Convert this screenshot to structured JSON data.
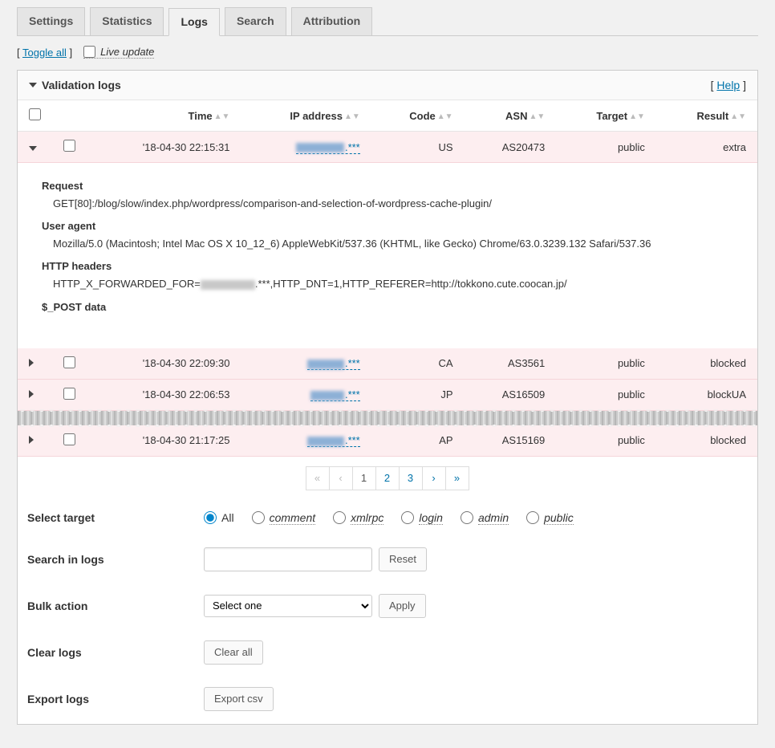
{
  "tabs": [
    {
      "label": "Settings"
    },
    {
      "label": "Statistics"
    },
    {
      "label": "Logs",
      "active": true
    },
    {
      "label": "Search"
    },
    {
      "label": "Attribution"
    }
  ],
  "toggle_all": "Toggle all",
  "live_update": "Live update",
  "panel_title": "Validation logs",
  "help": "Help",
  "columns": {
    "time": "Time",
    "ip": "IP address",
    "code": "Code",
    "asn": "ASN",
    "target": "Target",
    "result": "Result"
  },
  "rows": [
    {
      "time": "'18-04-30 22:15:31",
      "ip": ".***",
      "code": "US",
      "asn": "AS20473",
      "target": "public",
      "result": "extra",
      "expanded": true
    },
    {
      "time": "'18-04-30 22:09:30",
      "ip": ".***",
      "code": "CA",
      "asn": "AS3561",
      "target": "public",
      "result": "blocked",
      "expanded": false
    },
    {
      "time": "'18-04-30 22:06:53",
      "ip": ".***",
      "code": "JP",
      "asn": "AS16509",
      "target": "public",
      "result": "blockUA",
      "expanded": false
    },
    {
      "time": "'18-04-30 21:17:25",
      "ip": ".***",
      "code": "AP",
      "asn": "AS15169",
      "target": "public",
      "result": "blocked",
      "expanded": false
    }
  ],
  "detail": {
    "request_label": "Request",
    "request": "GET[80]:/blog/slow/index.php/wordpress/comparison-and-selection-of-wordpress-cache-plugin/",
    "ua_label": "User agent",
    "ua": "Mozilla/5.0 (Macintosh; Intel Mac OS X 10_12_6) AppleWebKit/537.36 (KHTML, like Gecko) Chrome/63.0.3239.132 Safari/537.36",
    "headers_label": "HTTP headers",
    "headers_pre": "HTTP_X_FORWARDED_FOR=",
    "headers_post": ".***,HTTP_DNT=1,HTTP_REFERER=http://tokkono.cute.coocan.jp/",
    "post_label": "$_POST data"
  },
  "pager": {
    "pages": [
      "1",
      "2",
      "3"
    ],
    "current": "1"
  },
  "form": {
    "select_target": "Select target",
    "targets": [
      {
        "label": "All",
        "italic": false,
        "checked": true
      },
      {
        "label": "comment",
        "italic": true
      },
      {
        "label": "xmlrpc",
        "italic": true
      },
      {
        "label": "login",
        "italic": true
      },
      {
        "label": "admin",
        "italic": true
      },
      {
        "label": "public",
        "italic": true
      }
    ],
    "search_label": "Search in logs",
    "reset": "Reset",
    "bulk_label": "Bulk action",
    "bulk_select": "Select one",
    "apply": "Apply",
    "clear_label": "Clear logs",
    "clear_btn": "Clear all",
    "export_label": "Export logs",
    "export_btn": "Export csv"
  },
  "chart_data": {
    "type": "table",
    "columns": [
      "Time",
      "IP address",
      "Code",
      "ASN",
      "Target",
      "Result"
    ],
    "rows": [
      [
        "'18-04-30 22:15:31",
        "***.***",
        "US",
        "AS20473",
        "public",
        "extra"
      ],
      [
        "'18-04-30 22:09:30",
        "***.***",
        "CA",
        "AS3561",
        "public",
        "blocked"
      ],
      [
        "'18-04-30 22:06:53",
        "***.***",
        "JP",
        "AS16509",
        "public",
        "blockUA"
      ],
      [
        "'18-04-30 21:17:25",
        "***.***",
        "AP",
        "AS15169",
        "public",
        "blocked"
      ]
    ]
  }
}
